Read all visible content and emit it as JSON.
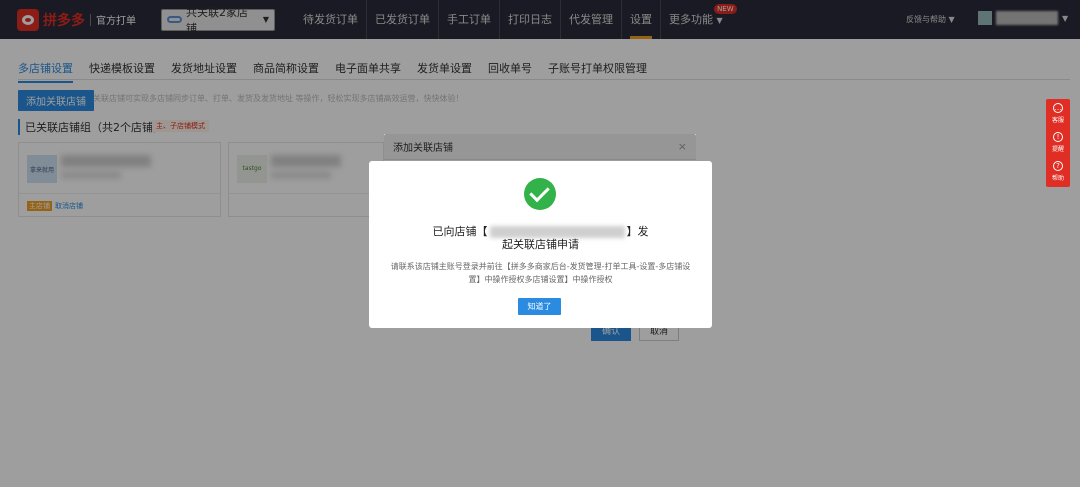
{
  "header": {
    "logo_text": "拼多多",
    "logo_sub": "官方打单",
    "shop_select": "共关联2家店铺",
    "nav": [
      "待发货订单",
      "已发货订单",
      "手工订单",
      "打印日志",
      "代发管理",
      "设置",
      "更多功能"
    ],
    "new_badge": "NEW",
    "feedback": "反馈与帮助"
  },
  "subtabs": [
    "多店铺设置",
    "快递模板设置",
    "发货地址设置",
    "商品简称设置",
    "电子面单共享",
    "发货单设置",
    "回收单号",
    "子账号打单权限管理"
  ],
  "main": {
    "add_button": "添加关联店铺",
    "hint": "关联店铺可实现多店铺同步订单、打单、发货及发货地址 等操作，轻松实现多店铺高效运营，快快体验！",
    "group_title": "已关联店铺组（共2个店铺）",
    "group_tag": "主、子店铺模式",
    "card1": {
      "thumb": "拿来就用",
      "main_tag": "主店铺",
      "link": "取消店铺"
    },
    "card2": {
      "thumb": "tastgo"
    }
  },
  "side_float": [
    "客服",
    "提醒",
    "帮助"
  ],
  "bg_dialog": {
    "title": "添加关联店铺",
    "close": "×",
    "confirm": "确认",
    "cancel": "取消"
  },
  "modal": {
    "line1_prefix": "已向店铺【",
    "line1_suffix": "】发",
    "line2": "起关联店铺申请",
    "sub": "请联系该店铺主账号登录并前往【拼多多商家后台-发货管理-打单工具-设置-多店铺设置】中操作授权多店铺设置】中操作授权",
    "ok": "知道了"
  },
  "colors": {
    "accent": "#2a8be0",
    "brand": "#e02e24",
    "success": "#33b24a"
  }
}
